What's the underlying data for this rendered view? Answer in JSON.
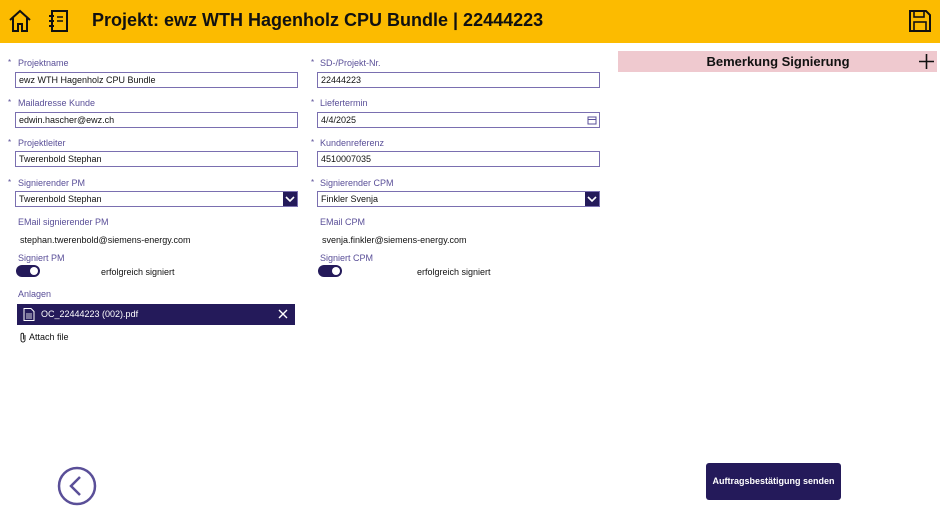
{
  "header": {
    "title": "Projekt: ewz WTH Hagenholz CPU Bundle | 22444223",
    "icons": [
      "home-icon",
      "notebook-icon",
      "save-icon"
    ]
  },
  "form": {
    "projektname": {
      "label": "Projektname",
      "value": "ewz WTH Hagenholz CPU Bundle"
    },
    "sd_projekt_nr": {
      "label": "SD-/Projekt-Nr.",
      "value": "22444223"
    },
    "mailadresse_kunde": {
      "label": "Mailadresse Kunde",
      "value": "edwin.hascher@ewz.ch"
    },
    "liefertermin": {
      "label": "Liefertermin",
      "value": "4/4/2025"
    },
    "projektleiter": {
      "label": "Projektleiter",
      "value": "Twerenbold Stephan"
    },
    "kundenreferenz": {
      "label": "Kundenreferenz",
      "value": "4510007035"
    },
    "signierender_pm": {
      "label": "Signierender PM",
      "value": "Twerenbold Stephan"
    },
    "signierender_cpm": {
      "label": "Signierender CPM",
      "value": "Finkler Svenja"
    },
    "email_pm": {
      "label": "EMail signierender PM",
      "value": "stephan.twerenbold@siemens-energy.com"
    },
    "email_cpm": {
      "label": "EMail CPM",
      "value": "svenja.finkler@siemens-energy.com"
    },
    "signiert_pm": {
      "label": "Signiert PM",
      "status": "erfolgreich signiert",
      "checked": true
    },
    "signiert_cpm": {
      "label": "Signiert CPM",
      "status": "erfolgreich signiert",
      "checked": true
    },
    "anlagen": {
      "label": "Anlagen",
      "file": "OC_22444223 (002).pdf",
      "attach_label": "Attach file"
    }
  },
  "remark": {
    "title": "Bemerkung Signierung"
  },
  "actions": {
    "send_label": "Auftragsbestätigung senden"
  },
  "colors": {
    "topbar": "#fcbb00",
    "accent": "#241a5a",
    "label": "#5a4f98",
    "remark_bg": "#efc9cf"
  }
}
